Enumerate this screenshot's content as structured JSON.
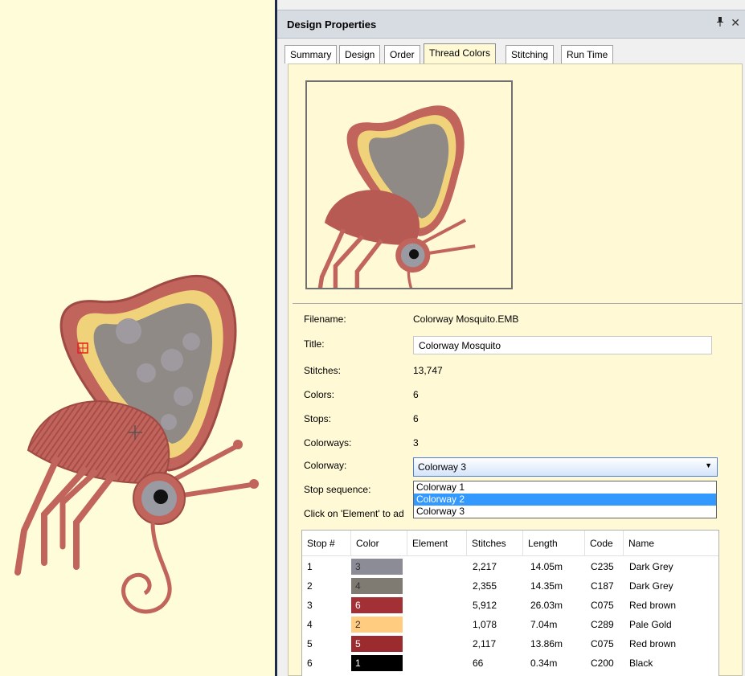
{
  "panel": {
    "title": "Design Properties",
    "pin_icon": "pin-icon",
    "close_icon": "close-icon",
    "close_glyph": "✕"
  },
  "tabs": [
    "Summary",
    "Design",
    "Order",
    "Thread Colors",
    "Stitching",
    "Run Time"
  ],
  "active_tab": "Thread Colors",
  "properties": {
    "filename_label": "Filename:",
    "filename": "Colorway Mosquito.EMB",
    "title_label": "Title:",
    "title_value": "Colorway Mosquito",
    "stitches_label": "Stitches:",
    "stitches": "13,747",
    "colors_label": "Colors:",
    "colors": "6",
    "stops_label": "Stops:",
    "stops": "6",
    "colorways_label": "Colorways:",
    "colorways": "3",
    "colorway_label": "Colorway:",
    "colorway_selected": "Colorway 3",
    "stop_sequence_label": "Stop sequence:",
    "hint": "Click on 'Element' to ad"
  },
  "dropdown": {
    "options": [
      "Colorway 1",
      "Colorway 2",
      "Colorway 3"
    ],
    "highlighted": "Colorway 2"
  },
  "table": {
    "headers": [
      "Stop #",
      "Color",
      "Element",
      "Stitches",
      "Length",
      "Code",
      "Name"
    ],
    "rows": [
      {
        "stop": "1",
        "color_num": "3",
        "color": "#8c8c96",
        "stitches": "2,217",
        "length": "14.05m",
        "code": "C235",
        "name": "Dark Grey"
      },
      {
        "stop": "2",
        "color_num": "4",
        "color": "#7f7b73",
        "stitches": "2,355",
        "length": "14.35m",
        "code": "C187",
        "name": "Dark Grey"
      },
      {
        "stop": "3",
        "color_num": "6",
        "color": "#a33035",
        "stitches": "5,912",
        "length": "26.03m",
        "code": "C075",
        "name": "Red brown"
      },
      {
        "stop": "4",
        "color_num": "2",
        "color": "#ffcc80",
        "stitches": "1,078",
        "length": "7.04m",
        "code": "C289",
        "name": "Pale Gold"
      },
      {
        "stop": "5",
        "color_num": "5",
        "color": "#9c2b30",
        "stitches": "2,117",
        "length": "13.86m",
        "code": "C075",
        "name": "Red brown"
      },
      {
        "stop": "6",
        "color_num": "1",
        "color": "#000000",
        "stitches": "66",
        "length": "0.34m",
        "code": "C200",
        "name": "Black"
      }
    ]
  },
  "colors": {
    "canvas_bg": "#fffcd9",
    "panel_bg": "#fff9d6",
    "selection": "#3399ff",
    "body_red": "#c0645c",
    "wing_gold": "#f0d27a"
  }
}
